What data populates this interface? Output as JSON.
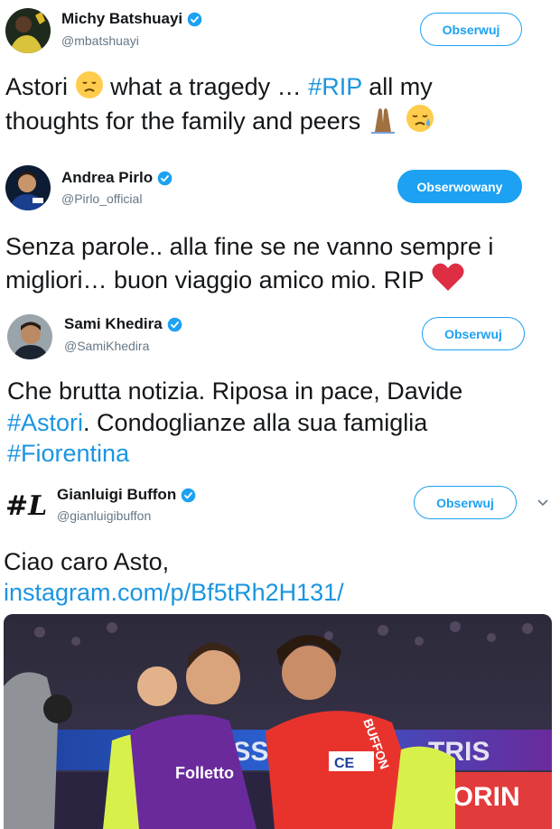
{
  "tweets": [
    {
      "name": "Michy Batshuayi",
      "handle": "@mbatshuayi",
      "button": "Obserwuj",
      "text_line1_a": "Astori",
      "text_line1_b": "what a tragedy …",
      "text_line1_hashtag": "#RIP",
      "text_line1_c": "all my",
      "text_line2": "thoughts for the family and peers"
    },
    {
      "name": "Andrea Pirlo",
      "handle": "@Pirlo_official",
      "button": "Obserwowany",
      "text_line1": "Senza parole.. alla fine se ne vanno sempre i",
      "text_line2": "migliori… buon viaggio amico mio. RIP"
    },
    {
      "name": "Sami Khedira",
      "handle": "@SamiKhedira",
      "button": "Obserwuj",
      "text_line1": "Che brutta notizia. Riposa in pace, Davide",
      "text_line2_hashtag": "#Astori",
      "text_line2": ". Condoglianze alla sua famiglia",
      "text_line3_hashtag": "#Fiorentina"
    },
    {
      "name": "Gianluigi Buffon",
      "handle": "@gianluigibuffon",
      "button": "Obserwuj",
      "text_line1": "Ciao caro Asto,",
      "link": "instagram.com/p/Bf5tRh2H131/",
      "avatar_text": "#L"
    }
  ],
  "photo": {
    "jersey_sponsor": "Folletto",
    "captain_band": "CE",
    "shirt_back": "BUFFON",
    "board_text_1": "BASSO",
    "board_text_2": "TRIS",
    "board_text_3": "FIORIN"
  },
  "colors": {
    "accent": "#1da1f2",
    "link": "#1b95e0",
    "fiorentina_purple": "#6a2a9c",
    "juve_red": "#e8332d"
  },
  "icons": [
    "verified-badge-icon",
    "chevron-down-icon"
  ]
}
